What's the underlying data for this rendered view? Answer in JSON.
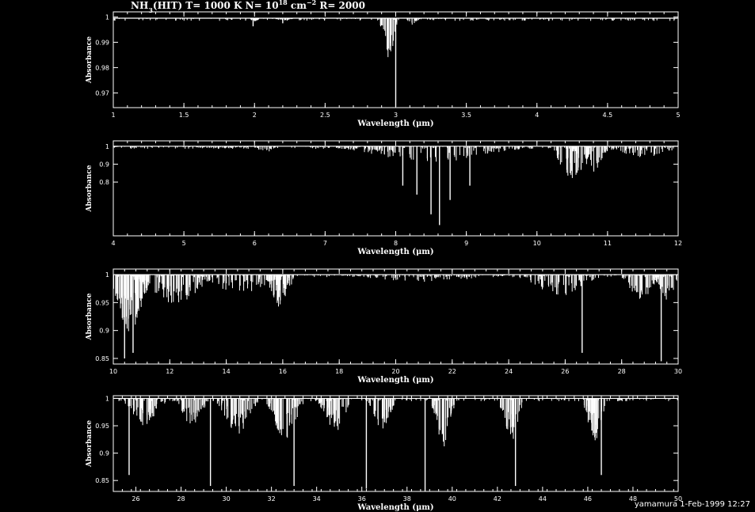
{
  "chart_data": [
    {
      "type": "line",
      "title_species": "NH",
      "title_sub": "3",
      "title_mid": "(HIT) T= 1000 K N= 10",
      "title_sup": "18",
      "title_unit": " cm",
      "title_unit_sup": "−2",
      "title_end": " R= 2000",
      "xlabel": "Wavelength (μm)",
      "ylabel": "Absorbance",
      "xlim": [
        1,
        5
      ],
      "ylim": [
        0.9642,
        1.002
      ],
      "xticks": [
        "1",
        "1.5",
        "2",
        "2.5",
        "3",
        "3.5",
        "4",
        "4.5",
        "5"
      ],
      "xtick_values": [
        1,
        1.5,
        2,
        2.5,
        3,
        3.5,
        4,
        4.5,
        5
      ],
      "yticks": [
        "1",
        "0.99",
        "0.98",
        "0.97"
      ],
      "ytick_values": [
        1,
        0.99,
        0.98,
        0.97
      ],
      "baseline": 0.9995,
      "bands": [
        {
          "x": 2.0,
          "w": 0.04,
          "depth": 0.9985,
          "n": 14
        },
        {
          "x": 2.2,
          "w": 0.09,
          "depth": 0.9988,
          "n": 20
        },
        {
          "x": 2.95,
          "w": 0.06,
          "depth": 0.986,
          "n": 16
        },
        {
          "x": 3.12,
          "w": 0.05,
          "depth": 0.9975,
          "n": 10
        },
        {
          "x": 3.3,
          "w": 0.06,
          "depth": 0.9992,
          "n": 8
        }
      ],
      "strong_lines": [
        {
          "x": 1.99,
          "y": 0.9963
        },
        {
          "x": 2.2,
          "y": 0.9975
        },
        {
          "x": 3.0,
          "y": 0.9645
        }
      ]
    },
    {
      "type": "line",
      "xlabel": "Wavelength (μm)",
      "ylabel": "Absorbance",
      "xlim": [
        4,
        12
      ],
      "ylim": [
        0.5,
        1.03
      ],
      "xticks": [
        "4",
        "5",
        "6",
        "7",
        "8",
        "9",
        "10",
        "11",
        "12"
      ],
      "xtick_values": [
        4,
        5,
        6,
        7,
        8,
        9,
        10,
        11,
        12
      ],
      "yticks": [
        "1",
        "0.9",
        "0.8"
      ],
      "ytick_values": [
        1,
        0.9,
        0.8
      ],
      "baseline": 1.0,
      "bands": [
        {
          "x": 5.5,
          "w": 0.6,
          "depth": 0.99,
          "n": 30
        },
        {
          "x": 6.15,
          "w": 0.15,
          "depth": 0.97,
          "n": 12
        },
        {
          "x": 7.2,
          "w": 0.45,
          "depth": 0.99,
          "n": 16
        },
        {
          "x": 8.5,
          "w": 1.3,
          "depth": 0.93,
          "n": 50
        },
        {
          "x": 10.5,
          "w": 0.3,
          "depth": 0.86,
          "n": 22
        },
        {
          "x": 10.75,
          "w": 0.25,
          "depth": 0.87,
          "n": 18
        },
        {
          "x": 11.5,
          "w": 0.55,
          "depth": 0.95,
          "n": 22
        }
      ],
      "strong_lines": [
        {
          "x": 8.3,
          "y": 0.73
        },
        {
          "x": 8.5,
          "y": 0.62
        },
        {
          "x": 8.62,
          "y": 0.56
        },
        {
          "x": 8.77,
          "y": 0.7
        },
        {
          "x": 8.1,
          "y": 0.78
        },
        {
          "x": 9.05,
          "y": 0.78
        }
      ]
    },
    {
      "type": "line",
      "xlabel": "Wavelength (μm)",
      "ylabel": "Absorbance",
      "xlim": [
        10,
        30
      ],
      "ylim": [
        0.84,
        1.01
      ],
      "xticks": [
        "10",
        "12",
        "14",
        "16",
        "18",
        "20",
        "22",
        "24",
        "26",
        "28",
        "30"
      ],
      "xtick_values": [
        10,
        12,
        14,
        16,
        18,
        20,
        22,
        24,
        26,
        28,
        30
      ],
      "yticks": [
        "1",
        "0.95",
        "0.9",
        "0.85"
      ],
      "ytick_values": [
        1,
        0.95,
        0.9,
        0.85
      ],
      "baseline": 1.0,
      "bands": [
        {
          "x": 10.6,
          "w": 0.7,
          "depth": 0.92,
          "n": 40
        },
        {
          "x": 12.2,
          "w": 1.5,
          "depth": 0.96,
          "n": 40
        },
        {
          "x": 14.5,
          "w": 1.8,
          "depth": 0.975,
          "n": 40
        },
        {
          "x": 15.9,
          "w": 0.5,
          "depth": 0.955,
          "n": 24
        },
        {
          "x": 21,
          "w": 3,
          "depth": 0.99,
          "n": 30
        },
        {
          "x": 25.8,
          "w": 1.4,
          "depth": 0.97,
          "n": 30
        },
        {
          "x": 28.7,
          "w": 0.7,
          "depth": 0.965,
          "n": 22
        },
        {
          "x": 29.6,
          "w": 0.4,
          "depth": 0.96,
          "n": 14
        }
      ],
      "strong_lines": [
        {
          "x": 10.4,
          "y": 0.85
        },
        {
          "x": 10.7,
          "y": 0.86
        },
        {
          "x": 26.6,
          "y": 0.86
        },
        {
          "x": 29.4,
          "y": 0.845
        }
      ]
    },
    {
      "type": "line",
      "xlabel": "Wavelength (μm)",
      "ylabel": "Absorbance",
      "xlim": [
        25,
        50
      ],
      "ylim": [
        0.83,
        1.005
      ],
      "xticks": [
        "26",
        "28",
        "30",
        "32",
        "34",
        "36",
        "38",
        "40",
        "42",
        "44",
        "46",
        "48",
        "50"
      ],
      "xtick_values": [
        26,
        28,
        30,
        32,
        34,
        36,
        38,
        40,
        42,
        44,
        46,
        48,
        50
      ],
      "yticks": [
        "1",
        "0.95",
        "0.9",
        "0.85"
      ],
      "ytick_values": [
        1,
        0.95,
        0.9,
        0.85
      ],
      "baseline": 1.0,
      "bands": [
        {
          "x": 26.4,
          "w": 0.9,
          "depth": 0.96,
          "n": 26
        },
        {
          "x": 28.5,
          "w": 0.7,
          "depth": 0.96,
          "n": 22
        },
        {
          "x": 30.5,
          "w": 0.9,
          "depth": 0.95,
          "n": 24
        },
        {
          "x": 32.6,
          "w": 0.8,
          "depth": 0.94,
          "n": 24
        },
        {
          "x": 34.8,
          "w": 0.7,
          "depth": 0.95,
          "n": 22
        },
        {
          "x": 36.9,
          "w": 0.6,
          "depth": 0.955,
          "n": 20
        },
        {
          "x": 39.6,
          "w": 0.5,
          "depth": 0.93,
          "n": 18
        },
        {
          "x": 42.6,
          "w": 0.5,
          "depth": 0.935,
          "n": 18
        },
        {
          "x": 46.3,
          "w": 0.5,
          "depth": 0.94,
          "n": 18
        }
      ],
      "strong_lines": [
        {
          "x": 25.7,
          "y": 0.86
        },
        {
          "x": 29.3,
          "y": 0.84
        },
        {
          "x": 33.0,
          "y": 0.84
        },
        {
          "x": 36.2,
          "y": 0.835
        },
        {
          "x": 38.8,
          "y": 0.83
        },
        {
          "x": 42.8,
          "y": 0.84
        },
        {
          "x": 46.6,
          "y": 0.86
        }
      ]
    }
  ],
  "footer": {
    "text": "yamamura  1-Feb-1999 12:27"
  },
  "colors": {
    "background": "#000000",
    "foreground": "#ffffff"
  }
}
